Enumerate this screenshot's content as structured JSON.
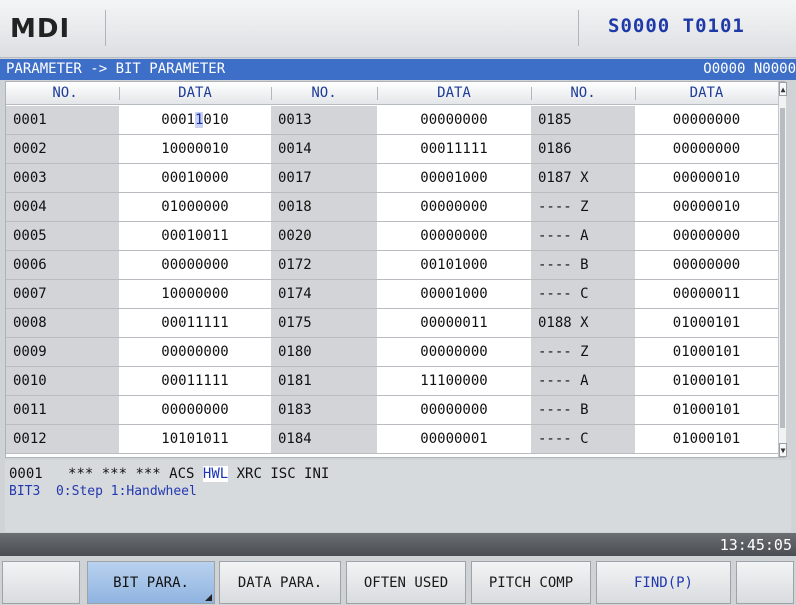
{
  "header": {
    "mode": "MDI",
    "spindle_tool": "S0000 T0101"
  },
  "path_bar": {
    "path": "PARAMETER -> BIT PARAMETER",
    "program": "O0000 N0000"
  },
  "table": {
    "headers": [
      "NO.",
      "DATA",
      "NO.",
      "DATA",
      "NO.",
      "DATA"
    ],
    "rows": [
      [
        "0001",
        "00011010",
        "0013",
        "00000000",
        "0185",
        "00000000"
      ],
      [
        "0002",
        "10000010",
        "0014",
        "00011111",
        "0186",
        "00000000"
      ],
      [
        "0003",
        "00010000",
        "0017",
        "00001000",
        "0187 X",
        "00000010"
      ],
      [
        "0004",
        "01000000",
        "0018",
        "00000000",
        "---- Z",
        "00000010"
      ],
      [
        "0005",
        "00010011",
        "0020",
        "00000000",
        "---- A",
        "00000000"
      ],
      [
        "0006",
        "00000000",
        "0172",
        "00101000",
        "---- B",
        "00000000"
      ],
      [
        "0007",
        "10000000",
        "0174",
        "00001000",
        "---- C",
        "00000011"
      ],
      [
        "0008",
        "00011111",
        "0175",
        "00000011",
        "0188 X",
        "01000101"
      ],
      [
        "0009",
        "00000000",
        "0180",
        "00000000",
        "---- Z",
        "01000101"
      ],
      [
        "0010",
        "00011111",
        "0181",
        "11100000",
        "---- A",
        "01000101"
      ],
      [
        "0011",
        "00000000",
        "0183",
        "00000000",
        "---- B",
        "01000101"
      ],
      [
        "0012",
        "10101011",
        "0184",
        "00000001",
        "---- C",
        "01000101"
      ]
    ],
    "cursor": {
      "row": 0,
      "col": 1,
      "digit_index": 4,
      "before": "0001",
      "digit": "1",
      "after": "010"
    }
  },
  "description": {
    "param_no": "0001",
    "bits_before": "*** *** *** ACS",
    "bit_selected": "HWL",
    "bits_after": "XRC ISC INI",
    "line2": "BIT3  0:Step 1:Handwheel"
  },
  "status": {
    "time": "13:45:05"
  },
  "softkeys": [
    {
      "label": "",
      "active": false
    },
    {
      "label": "BIT PARA.",
      "active": true
    },
    {
      "label": "DATA PARA.",
      "active": false
    },
    {
      "label": "OFTEN USED",
      "active": false
    },
    {
      "label": "PITCH COMP",
      "active": false
    },
    {
      "label": "FIND(P)",
      "active": false
    },
    {
      "label": "",
      "active": false
    }
  ],
  "colors": {
    "accent_blue": "#3d6fc8",
    "header_text": "#1e3c9a",
    "highlight": "#c9d2f2"
  }
}
